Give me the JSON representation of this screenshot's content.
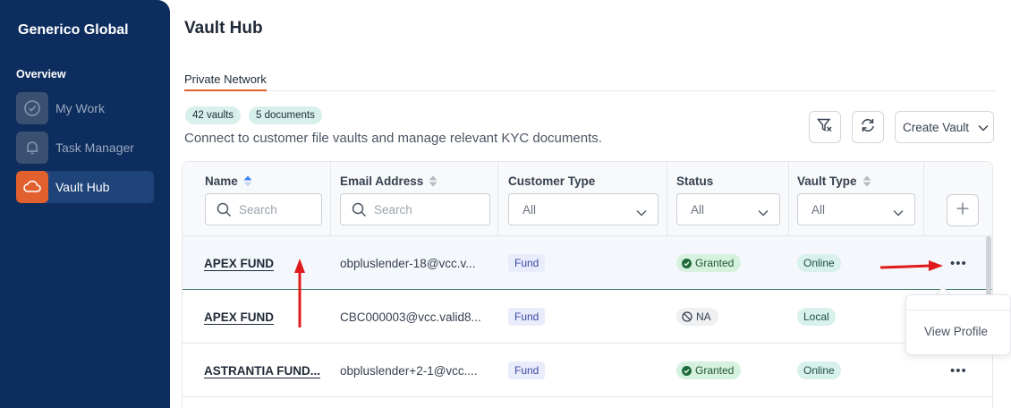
{
  "sidebar": {
    "brand": "Generico Global",
    "section": "Overview",
    "items": [
      {
        "label": "My Work",
        "icon": "check-circle-icon",
        "active": false
      },
      {
        "label": "Task Manager",
        "icon": "bell-icon",
        "active": false
      },
      {
        "label": "Vault Hub",
        "icon": "cloud-icon",
        "active": true
      }
    ]
  },
  "header": {
    "title": "Vault Hub",
    "tabs": [
      {
        "label": "Private Network",
        "active": true
      }
    ]
  },
  "summary": {
    "vaults_chip": "42 vaults",
    "documents_chip": "5 documents",
    "description": "Connect to customer file vaults and manage relevant KYC documents."
  },
  "toolbar": {
    "clear_filter_icon": "filter-clear-icon",
    "refresh_icon": "refresh-icon",
    "create_vault_label": "Create Vault"
  },
  "table": {
    "columns": [
      {
        "label": "Name",
        "filter_type": "search",
        "filter_placeholder": "Search",
        "sortable": true,
        "sorted": "asc"
      },
      {
        "label": "Email Address",
        "filter_type": "search",
        "filter_placeholder": "Search",
        "sortable": true
      },
      {
        "label": "Customer Type",
        "filter_type": "select",
        "filter_value": "All",
        "sortable": false
      },
      {
        "label": "Status",
        "filter_type": "select",
        "filter_value": "All",
        "sortable": false
      },
      {
        "label": "Vault Type",
        "filter_type": "select",
        "filter_value": "All",
        "sortable": true
      }
    ],
    "rows": [
      {
        "name": "APEX FUND",
        "email": "obpluslender-18@vcc.v...",
        "customer_type": "Fund",
        "status": "Granted",
        "vault_type": "Online"
      },
      {
        "name": "APEX FUND",
        "email": "CBC000003@vcc.valid8...",
        "customer_type": "Fund",
        "status": "NA",
        "vault_type": "Local"
      },
      {
        "name": "ASTRANTIA FUND...",
        "email": "obpluslender+2-1@vcc....",
        "customer_type": "Fund",
        "status": "Granted",
        "vault_type": "Online"
      }
    ]
  },
  "row_menu": {
    "items": [
      "View Profile"
    ]
  },
  "colors": {
    "sidebar_bg": "#0d2d5e",
    "accent": "#e1602e",
    "annotation_arrow": "#e01b1b"
  }
}
